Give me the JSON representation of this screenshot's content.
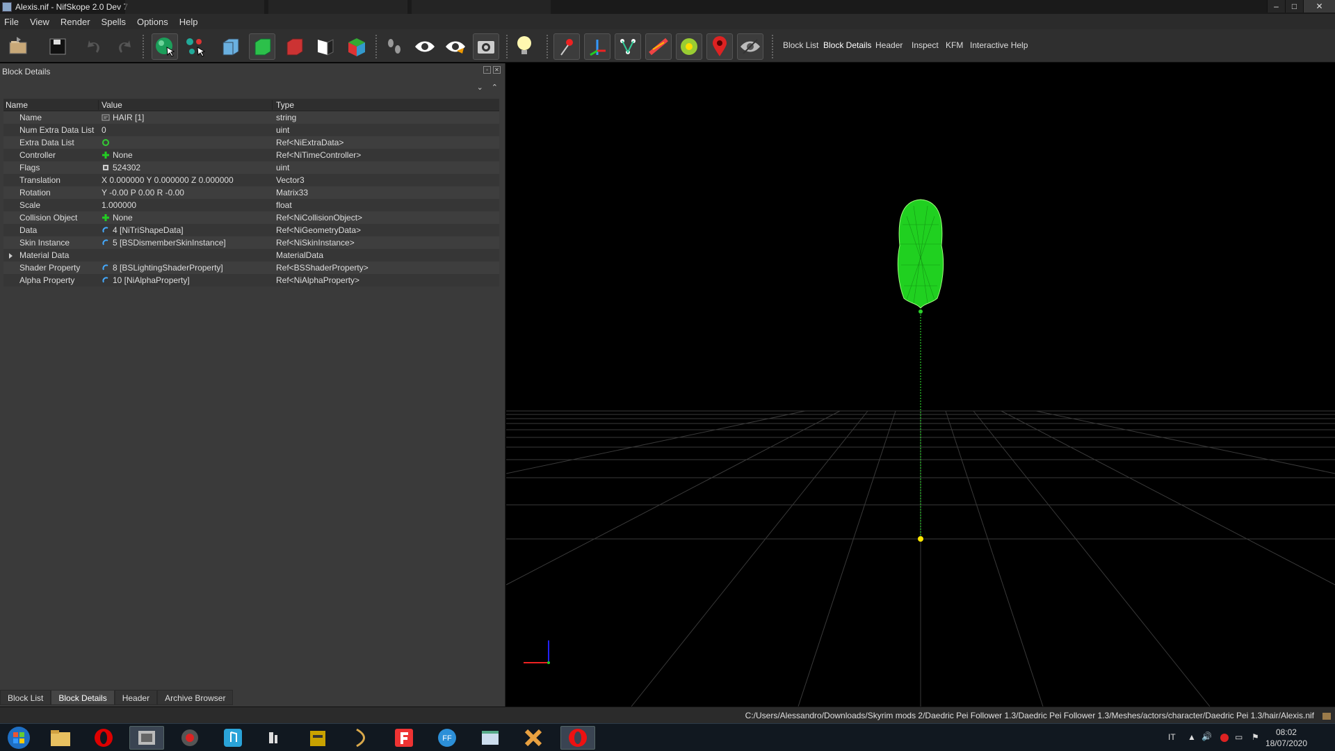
{
  "window": {
    "title": "Alexis.nif - NifSkope 2.0 Dev 7",
    "controls": {
      "minimize": "–",
      "maximize": "□",
      "close": "✕"
    }
  },
  "menu": [
    "File",
    "View",
    "Render",
    "Spells",
    "Options",
    "Help"
  ],
  "toolbar": {
    "icons": [
      "load-icon",
      "save-icon",
      "undo-icon",
      "redo-icon",
      "select-object-icon",
      "select-vertex-icon",
      "view-wireframe-icon",
      "view-solid-icon",
      "view-flat-icon",
      "view-back-icon",
      "view-textured-icon",
      "footsteps-icon",
      "eye-icon",
      "eye-hidden-icon",
      "screenshot-icon",
      "light-icon",
      "collision-icon",
      "axes-icon",
      "nodes-icon",
      "constraints-icon",
      "markers-icon",
      "furniture-icon",
      "hidden-icon"
    ],
    "dock_links": [
      "Block List",
      "Block Details",
      "Header",
      "Inspect",
      "KFM",
      "Interactive Help"
    ]
  },
  "dock": {
    "title": "Block Details",
    "columns": {
      "name": "Name",
      "value": "Value",
      "type": "Type"
    },
    "rows": [
      {
        "name": "Name",
        "value": "HAIR [1]",
        "type": "string",
        "icon": "text-icon"
      },
      {
        "name": "Num Extra Data List",
        "value": "0",
        "type": "uint",
        "icon": ""
      },
      {
        "name": "Extra Data List",
        "value": "",
        "type": "Ref<NiExtraData>",
        "icon": "refresh-icon"
      },
      {
        "name": "Controller",
        "value": "None",
        "type": "Ref<NiTimeController>",
        "icon": "plus-icon"
      },
      {
        "name": "Flags",
        "value": "524302",
        "type": "uint",
        "icon": "flag-icon"
      },
      {
        "name": "Translation",
        "value": "X 0.000000 Y 0.000000 Z 0.000000",
        "type": "Vector3",
        "icon": ""
      },
      {
        "name": "Rotation",
        "value": "Y -0.00 P 0.00 R -0.00",
        "type": "Matrix33",
        "icon": ""
      },
      {
        "name": "Scale",
        "value": "1.000000",
        "type": "float",
        "icon": ""
      },
      {
        "name": "Collision Object",
        "value": "None",
        "type": "Ref<NiCollisionObject>",
        "icon": "plus-icon"
      },
      {
        "name": "Data",
        "value": "4 [NiTriShapeData]",
        "type": "Ref<NiGeometryData>",
        "icon": "link-icon"
      },
      {
        "name": "Skin Instance",
        "value": "5 [BSDismemberSkinInstance]",
        "type": "Ref<NiSkinInstance>",
        "icon": "link-icon"
      },
      {
        "name": "Material Data",
        "value": "",
        "type": "MaterialData",
        "icon": "",
        "expandable": true
      },
      {
        "name": "Shader Property",
        "value": "8 [BSLightingShaderProperty]",
        "type": "Ref<BSShaderProperty>",
        "icon": "link-icon"
      },
      {
        "name": "Alpha Property",
        "value": "10 [NiAlphaProperty]",
        "type": "Ref<NiAlphaProperty>",
        "icon": "link-icon"
      }
    ],
    "tabs": [
      "Block List",
      "Block Details",
      "Header",
      "Archive Browser"
    ],
    "active_tab": "Block Details"
  },
  "status": {
    "path": "C:/Users/Alessandro/Downloads/Skyrim mods 2/Daedric Pei Follower 1.3/Daedric Pei Follower 1.3/Meshes/actors/character/Daedric Pei 1.3/hair/Alexis.nif"
  },
  "taskbar": {
    "apps": [
      "start-orb-icon",
      "file-explorer-icon",
      "opera-icon",
      "video-editor-icon",
      "game-icon",
      "music-icon",
      "audio-tool-icon",
      "archive-icon",
      "bow-icon",
      "fraps-icon",
      "ffdec-icon",
      "window-app-icon",
      "nifskope-icon",
      "opera-icon"
    ],
    "language": "IT",
    "time": "08:02",
    "date": "18/07/2020"
  }
}
